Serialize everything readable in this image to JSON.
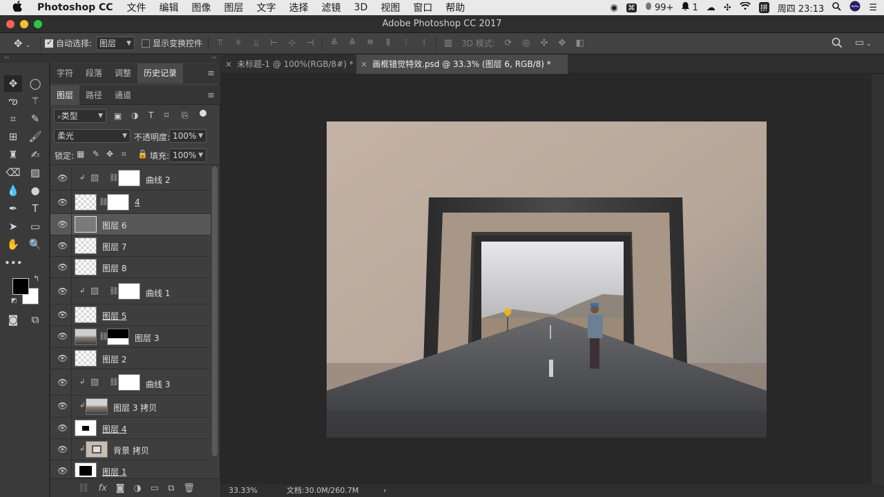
{
  "menubar": {
    "app_name": "Photoshop CC",
    "menus": [
      "文件",
      "编辑",
      "图像",
      "图层",
      "文字",
      "选择",
      "滤镜",
      "3D",
      "视图",
      "窗口",
      "帮助"
    ],
    "status": {
      "notifications": "99+",
      "alerts": "1",
      "clock": "周四 23:13"
    }
  },
  "window": {
    "title": "Adobe Photoshop CC 2017"
  },
  "options": {
    "auto_select_label": "自动选择:",
    "auto_select_value": "图层",
    "show_transform_label": "显示变换控件",
    "mode_3d_label": "3D 模式:"
  },
  "panel_group1": {
    "tabs": [
      "字符",
      "段落",
      "调整",
      "历史记录"
    ],
    "active": "历史记录"
  },
  "layers_panel": {
    "tabs": [
      "图层",
      "路径",
      "通道"
    ],
    "active": "图层",
    "filter": "类型",
    "blend_mode": "柔光",
    "opacity_label": "不透明度:",
    "opacity_value": "100%",
    "lock_label": "锁定:",
    "fill_label": "填充:",
    "fill_value": "100%",
    "layers": [
      {
        "name": "曲线 2",
        "kind": "adjustment",
        "clipped": true
      },
      {
        "name": "4",
        "kind": "smart-mask",
        "clipped": false
      },
      {
        "name": "图层 6",
        "kind": "gray",
        "clipped": false,
        "selected": true
      },
      {
        "name": "图层 7",
        "kind": "pixel",
        "clipped": false
      },
      {
        "name": "图层 8",
        "kind": "pixel",
        "clipped": false
      },
      {
        "name": "曲线 1",
        "kind": "adjustment",
        "clipped": true
      },
      {
        "name": "图层 5",
        "kind": "pixel",
        "clipped": false
      },
      {
        "name": "图层 3",
        "kind": "photo-mask",
        "clipped": false
      },
      {
        "name": "图层 2",
        "kind": "pixel",
        "clipped": false
      },
      {
        "name": "曲线 3",
        "kind": "adjustment",
        "clipped": true
      },
      {
        "name": "图层 3 拷贝",
        "kind": "photo",
        "clipped": true
      },
      {
        "name": "图层 4",
        "kind": "black-rect",
        "clipped": false
      },
      {
        "name": "背景 拷贝",
        "kind": "frame",
        "clipped": true
      },
      {
        "name": "图层 1",
        "kind": "black-full",
        "clipped": false
      }
    ]
  },
  "documents": {
    "tabs": [
      {
        "label": "未标题-1 @ 100%(RGB/8#) *"
      },
      {
        "label": "画框错觉特效.psd @ 33.3% (图层 6, RGB/8) *"
      }
    ]
  },
  "status_bar": {
    "zoom": "33.33%",
    "doc_info": "文档:30.0M/260.7M"
  },
  "colors": {
    "foreground": "#000000",
    "background": "#ffffff",
    "wall": "#b9a99c",
    "road": "#55565a"
  }
}
